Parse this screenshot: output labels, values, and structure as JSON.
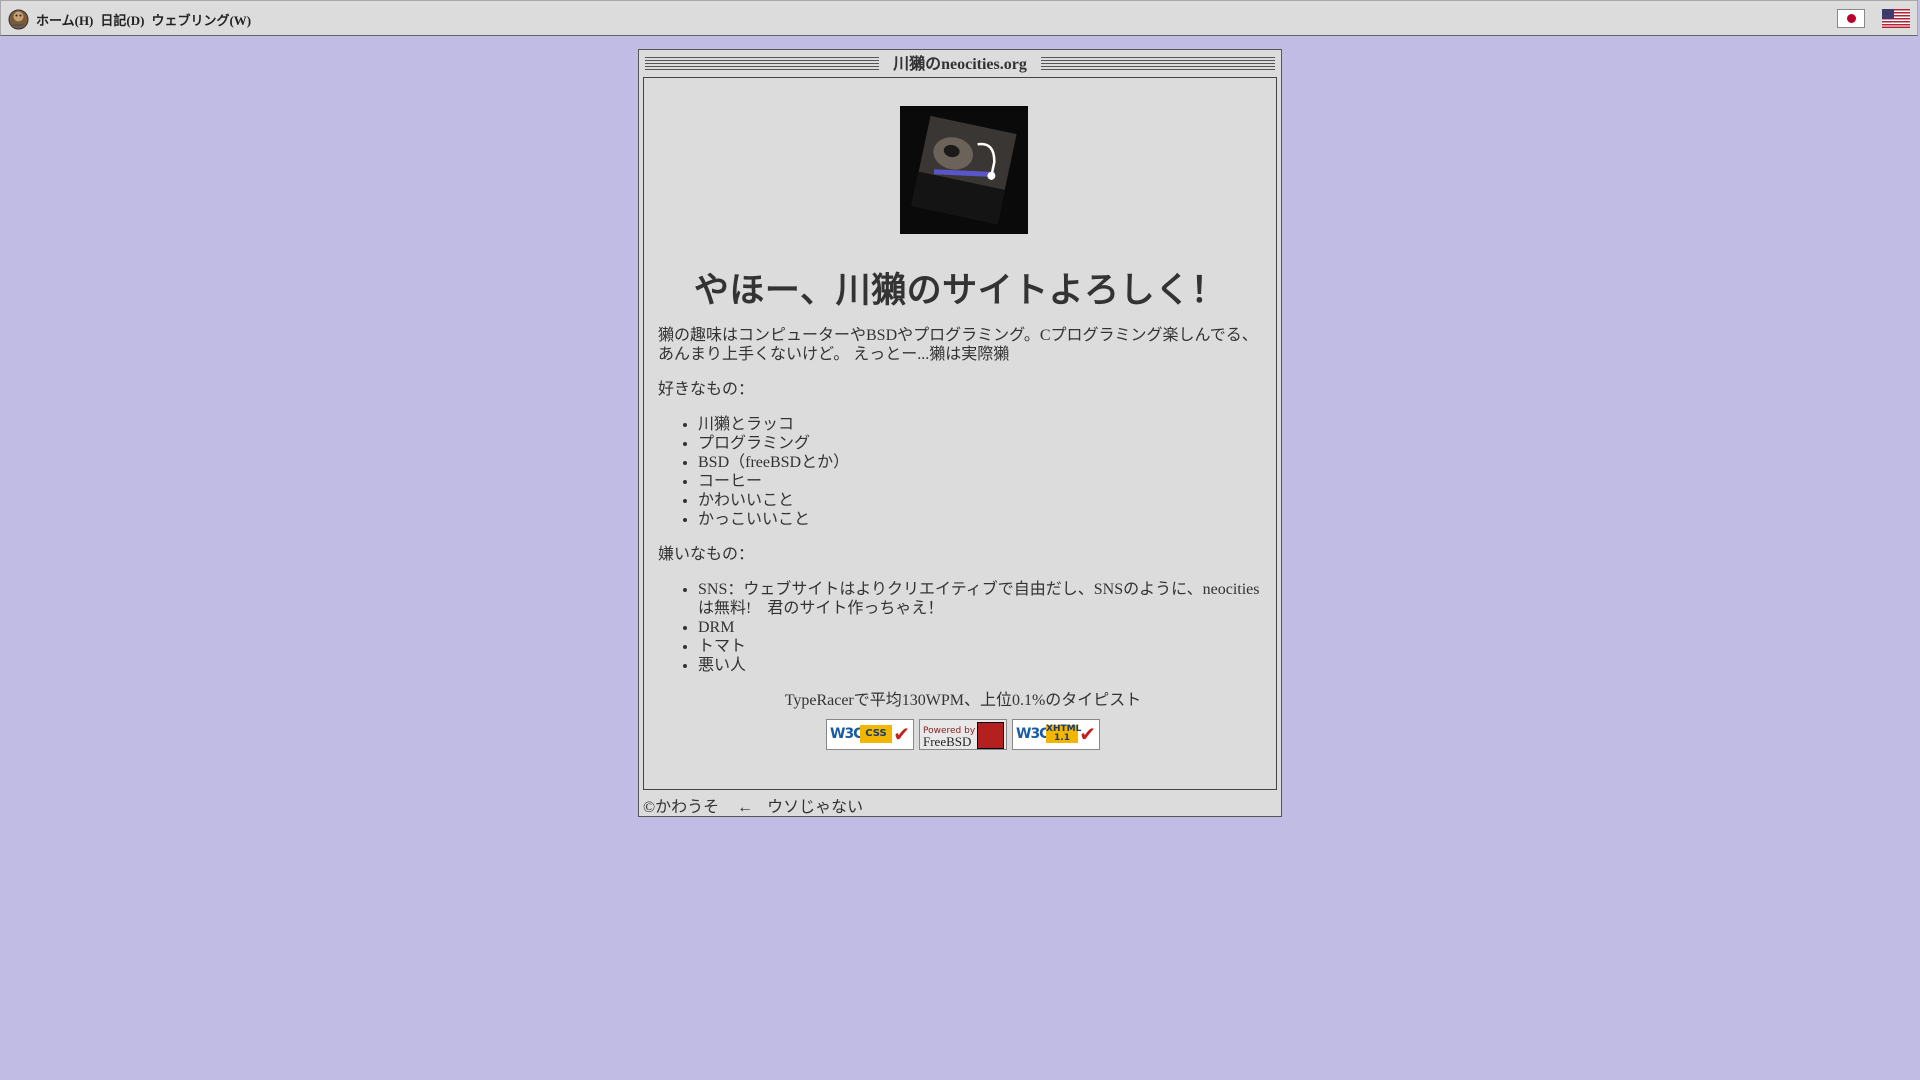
{
  "menubar": {
    "logo_icon": "site-logo-icon",
    "items": [
      {
        "label": "ホーム(H)"
      },
      {
        "label": "日記(D)"
      },
      {
        "label": "ウェブリング(W)"
      }
    ],
    "flags": [
      "flag-japan-icon",
      "flag-usa-icon"
    ]
  },
  "window": {
    "title": "川獺のneocities.org"
  },
  "main": {
    "heading": "やほー、川獺のサイトよろしく！",
    "intro": "獺の趣味はコンピューターやBSDやプログラミング。Cプログラミング楽しんでる、あんまり上手くないけど。 えっとー...獺は実際獺",
    "likes_label": "好きなもの：",
    "likes": [
      "川獺とラッコ",
      "プログラミング",
      "BSD（freeBSDとか）",
      "コーヒー",
      "かわいいこと",
      "かっこいいこと"
    ],
    "dislikes_label": "嫌いなもの：",
    "dislikes": [
      "SNS：ウェブサイトはよりクリエイティブで自由だし、SNSのように、neocitiesは無料!　君のサイト作っちゃえ！",
      "DRM",
      "トマト",
      "悪い人"
    ],
    "typeracer": "TypeRacerで平均130WPM、上位0.1%のタイピスト",
    "badges": {
      "css": {
        "w3c": "W3C",
        "tag": "CSS"
      },
      "freebsd": {
        "small": "Powered by",
        "big": "FreeBSD"
      },
      "xhtml": {
        "w3c": "W3C",
        "tag_top": "XHTML",
        "tag_bottom": "1.1"
      }
    }
  },
  "footer": {
    "copyright": "©かわうそ",
    "back_arrow": "←",
    "link": "ウソじゃない"
  },
  "colors": {
    "background": "#c0bce3",
    "panel": "#dcdcdc",
    "text": "#333333"
  }
}
